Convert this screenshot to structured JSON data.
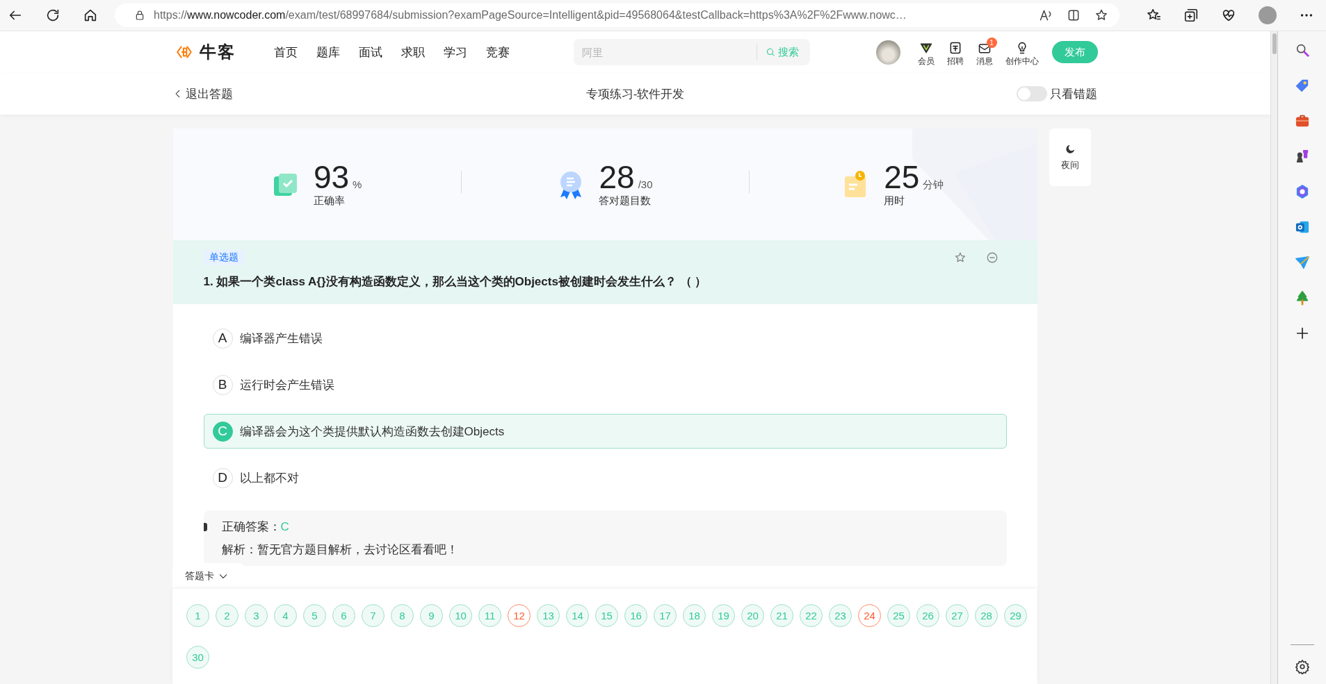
{
  "browser": {
    "url": {
      "scheme": "https://",
      "host": "www.nowcoder.com",
      "rest": "/exam/test/68997684/submission?examPageSource=Intelligent&pid=49568064&testCallback=https%3A%2F%2Fwww.nowc…"
    }
  },
  "header": {
    "logo": "牛客",
    "nav": [
      "首页",
      "题库",
      "面试",
      "求职",
      "学习",
      "竞赛"
    ],
    "search": {
      "placeholder": "阿里",
      "button": "搜索"
    },
    "tools": [
      {
        "kind": "vip",
        "label": "会员"
      },
      {
        "kind": "jobs",
        "label": "招聘"
      },
      {
        "kind": "message",
        "label": "消息",
        "badge": "1"
      },
      {
        "kind": "create",
        "label": "创作中心"
      }
    ],
    "publish": "发布"
  },
  "subheader": {
    "back": "退出答题",
    "title": "专项练习-软件开发",
    "toggle": {
      "label": "只看错题",
      "on": false
    }
  },
  "stats": [
    {
      "kind": "accuracy",
      "value": "93",
      "unit": "%",
      "label": "正确率"
    },
    {
      "kind": "count",
      "value": "28",
      "unit": "/30",
      "label": "答对题目数"
    },
    {
      "kind": "time",
      "value": "25",
      "unit": "分钟",
      "label": "用时"
    }
  ],
  "night": "夜间",
  "question": {
    "type": "单选题",
    "text": "1. 如果一个类class A{}没有构造函数定义，那么当这个类的Objects被创建时会发生什么？ （    ）",
    "options": [
      {
        "letter": "A",
        "text": "编译器产生错误",
        "selected": false
      },
      {
        "letter": "B",
        "text": "运行时会产生错误",
        "selected": false
      },
      {
        "letter": "C",
        "text": "编译器会为这个类提供默认构造函数去创建Objects",
        "selected": true
      },
      {
        "letter": "D",
        "text": "以上都不对",
        "selected": false
      }
    ]
  },
  "analysis": {
    "answer_label": "正确答案：",
    "answer": "C",
    "explanation": "解析：暂无官方题目解析，去讨论区看看吧！"
  },
  "answer_card": {
    "label": "答题卡",
    "items": [
      {
        "number": "1",
        "correct": true
      },
      {
        "number": "2",
        "correct": true
      },
      {
        "number": "3",
        "correct": true
      },
      {
        "number": "4",
        "correct": true
      },
      {
        "number": "5",
        "correct": true
      },
      {
        "number": "6",
        "correct": true
      },
      {
        "number": "7",
        "correct": true
      },
      {
        "number": "8",
        "correct": true
      },
      {
        "number": "9",
        "correct": true
      },
      {
        "number": "10",
        "correct": true
      },
      {
        "number": "11",
        "correct": true
      },
      {
        "number": "12",
        "correct": false
      },
      {
        "number": "13",
        "correct": true
      },
      {
        "number": "14",
        "correct": true
      },
      {
        "number": "15",
        "correct": true
      },
      {
        "number": "16",
        "correct": true
      },
      {
        "number": "17",
        "correct": true
      },
      {
        "number": "18",
        "correct": true
      },
      {
        "number": "19",
        "correct": true
      },
      {
        "number": "20",
        "correct": true
      },
      {
        "number": "21",
        "correct": true
      },
      {
        "number": "22",
        "correct": true
      },
      {
        "number": "23",
        "correct": true
      },
      {
        "number": "24",
        "correct": false
      },
      {
        "number": "25",
        "correct": true
      },
      {
        "number": "26",
        "correct": true
      },
      {
        "number": "27",
        "correct": true
      },
      {
        "number": "28",
        "correct": true
      },
      {
        "number": "29",
        "correct": true
      },
      {
        "number": "30",
        "correct": true
      }
    ]
  }
}
